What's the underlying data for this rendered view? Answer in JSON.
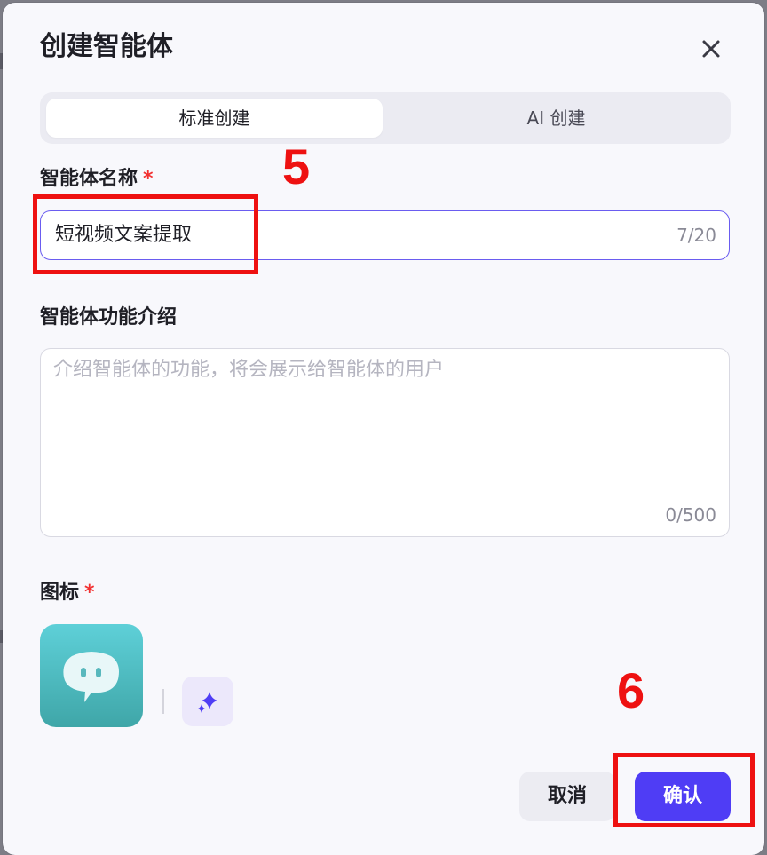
{
  "dialog": {
    "title": "创建智能体",
    "close_icon": "close-icon"
  },
  "tabs": [
    {
      "label": "标准创建",
      "active": true
    },
    {
      "label": "AI 创建",
      "active": false
    }
  ],
  "form": {
    "name": {
      "label": "智能体名称",
      "required_mark": "*",
      "value": "短视频文案提取",
      "counter": "7/20"
    },
    "description": {
      "label": "智能体功能介绍",
      "placeholder": "介绍智能体的功能，将会展示给智能体的用户",
      "counter": "0/500"
    },
    "icon": {
      "label": "图标",
      "required_mark": "*",
      "tile_icon": "chat-bubble-icon",
      "ai_generate_icon": "sparkle-icon"
    }
  },
  "footer": {
    "cancel_label": "取消",
    "confirm_label": "确认"
  },
  "annotations": {
    "step_5": "5",
    "step_6": "6"
  },
  "colors": {
    "accent": "#4f3df5",
    "required": "#f23030",
    "annotation": "#ee1111",
    "icon_tile": "#4fbcc2"
  }
}
